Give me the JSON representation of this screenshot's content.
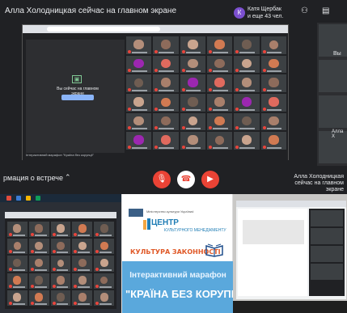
{
  "meet": {
    "title": "Алла Холодницкая сейчас на главном экране",
    "viewer_name": "Катя Щербак",
    "viewer_sub": "и еще 43 чел.",
    "viewer_initial": "К",
    "presenting_text": "Вы сейчас на главном экране",
    "side_label_you": "Вы",
    "side_label_alla": "Алла Х",
    "info_label": "рмация о встрече",
    "presenter_caption": "Алла Холодницкая сейчас на главном экране",
    "inner_marathon": "Інтерактивний марафон \"Країна без корупції\"",
    "icons": [
      "people-icon",
      "chat-icon",
      "mic-off-icon",
      "end-call-icon",
      "camera-off-icon"
    ]
  },
  "poster": {
    "ministry": "Міністерство культури Україниd",
    "centre": "ЦЕНТР",
    "centre_sub": "КУЛЬТУРНОГО МЕНЕДЖМЕНТУ",
    "culture_law": "КУЛЬТУРА ЗАКОННОСТІ",
    "line1": "Інтерактивний марафон",
    "line2": "\"КРАЇНА БЕЗ КОРУПЦІЇ\""
  },
  "colors": {
    "meet_bg": "#202124",
    "accent_red": "#ea4335",
    "poster_blue": "#5aa8dc",
    "poster_orange": "#e05a29"
  }
}
